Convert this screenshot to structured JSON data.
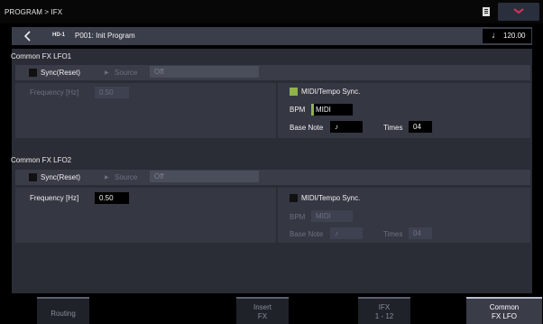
{
  "header": {
    "breadcrumb": "PROGRAM > IFX",
    "memory_icon": "document-icon",
    "menu_icon": "chevron-down-icon"
  },
  "program": {
    "back_icon": "chevron-left-icon",
    "bank": "HD-1",
    "name": "P001: Init Program",
    "tempo_icon": "quarter-note-icon",
    "tempo": "120.00"
  },
  "lfo1": {
    "title": "Common FX LFO1",
    "sync_label": "Sync(Reset)",
    "sync_checked": false,
    "source_label": "Source",
    "source_value": "Off",
    "frequency_label": "Frequency [Hz]",
    "frequency_value": "0.50",
    "midi_sync_label": "MIDI/Tempo Sync.",
    "midi_sync_checked": true,
    "bpm_label": "BPM",
    "bpm_value": "MIDI",
    "base_note_label": "Base Note",
    "base_note_value": "♪",
    "times_label": "Times",
    "times_value": "04"
  },
  "lfo2": {
    "title": "Common FX LFO2",
    "sync_label": "Sync(Reset)",
    "sync_checked": false,
    "source_label": "Source",
    "source_value": "Off",
    "frequency_label": "Frequency [Hz]",
    "frequency_value": "0.50",
    "midi_sync_label": "MIDI/Tempo Sync.",
    "midi_sync_checked": false,
    "bpm_label": "BPM",
    "bpm_value": "MIDI",
    "base_note_label": "Base Note",
    "base_note_value": "♪",
    "times_label": "Times",
    "times_value": "04"
  },
  "tabs": [
    {
      "label_line1": "Routing",
      "label_line2": "",
      "active": false
    },
    {
      "label_line1": "Insert",
      "label_line2": "FX",
      "active": false
    },
    {
      "label_line1": "IFX",
      "label_line2": "1 - 12",
      "active": false
    },
    {
      "label_line1": "Common",
      "label_line2": "FX LFO",
      "active": true
    }
  ],
  "colors": {
    "accent_green": "#8fb34a",
    "background": "#2a2c36",
    "header_bar": "#3a3e4b"
  }
}
